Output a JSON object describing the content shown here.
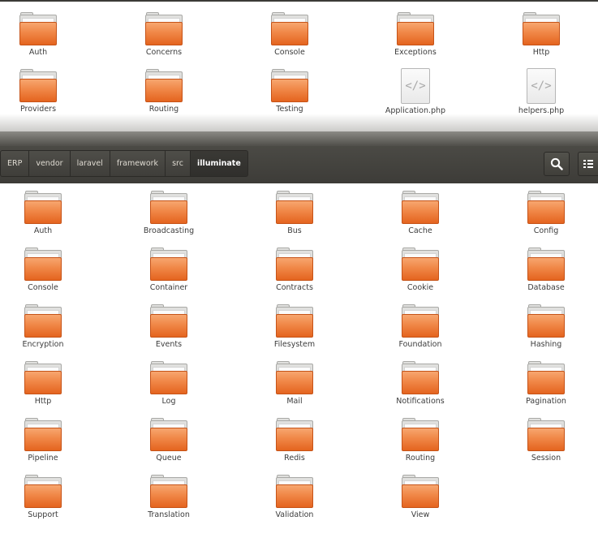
{
  "top_pane": {
    "items": [
      {
        "label": "Auth",
        "kind": "folder"
      },
      {
        "label": "Concerns",
        "kind": "folder"
      },
      {
        "label": "Console",
        "kind": "folder"
      },
      {
        "label": "Exceptions",
        "kind": "folder"
      },
      {
        "label": "Http",
        "kind": "folder"
      },
      {
        "label": "Providers",
        "kind": "folder"
      },
      {
        "label": "Routing",
        "kind": "folder"
      },
      {
        "label": "Testing",
        "kind": "folder"
      },
      {
        "label": "Application.php",
        "kind": "file",
        "glyph": "</>"
      },
      {
        "label": "helpers.php",
        "kind": "file",
        "glyph": "</>"
      }
    ]
  },
  "breadcrumb": {
    "items": [
      "ERP",
      "vendor",
      "laravel",
      "framework",
      "src",
      "illuminate"
    ],
    "active_index": 5
  },
  "toolbar": {
    "search_icon": "search-icon",
    "view_icon": "list-view-icon"
  },
  "bottom_pane": {
    "items": [
      {
        "label": "Auth"
      },
      {
        "label": "Broadcasting"
      },
      {
        "label": "Bus"
      },
      {
        "label": "Cache"
      },
      {
        "label": "Config"
      },
      {
        "label": "Console"
      },
      {
        "label": "Container"
      },
      {
        "label": "Contracts"
      },
      {
        "label": "Cookie"
      },
      {
        "label": "Database"
      },
      {
        "label": "Encryption"
      },
      {
        "label": "Events"
      },
      {
        "label": "Filesystem"
      },
      {
        "label": "Foundation"
      },
      {
        "label": "Hashing"
      },
      {
        "label": "Http"
      },
      {
        "label": "Log"
      },
      {
        "label": "Mail"
      },
      {
        "label": "Notifications"
      },
      {
        "label": "Pagination"
      },
      {
        "label": "Pipeline"
      },
      {
        "label": "Queue"
      },
      {
        "label": "Redis"
      },
      {
        "label": "Routing"
      },
      {
        "label": "Session"
      },
      {
        "label": "Support"
      },
      {
        "label": "Translation"
      },
      {
        "label": "Validation"
      },
      {
        "label": "View"
      }
    ]
  },
  "colors": {
    "folder_orange": "#f08747",
    "toolbar_dark": "#3d3c38"
  }
}
